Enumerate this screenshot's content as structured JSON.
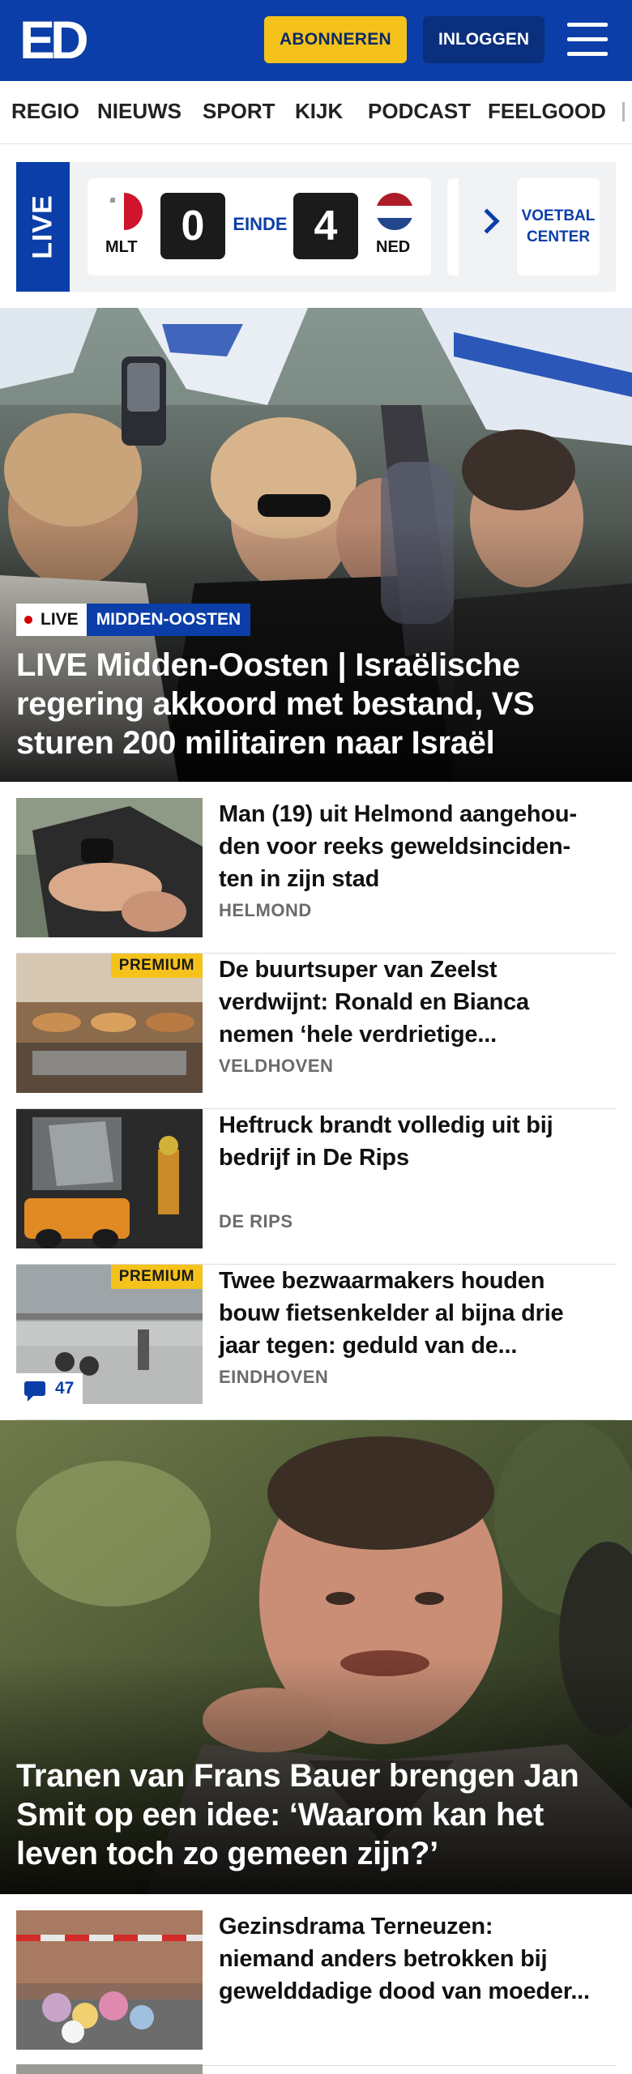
{
  "header": {
    "logo": "ED",
    "subscribe_label": "ABONNEREN",
    "login_label": "INLOGGEN",
    "menu_icon": "hamburger-icon",
    "color": "#0b3ea8"
  },
  "nav": {
    "items": [
      "REGIO",
      "NIEUWS",
      "SPORT",
      "KIJK",
      "PODCAST",
      "FEELGOOD"
    ]
  },
  "live_scores": {
    "tab_label": "LIVE",
    "match": {
      "home_code": "MLT",
      "home_score": "0",
      "status": "EINDE",
      "away_score": "4",
      "away_code": "NED"
    },
    "voetbal_center_label": "VOETBAL CENTER"
  },
  "hero_1": {
    "tag_live": "LIVE",
    "tag_category": "MIDDEN-OOSTEN",
    "title_lines": [
      "LIVE Midden-Oosten | Israëlische",
      "regering akkoord met bestand, VS",
      "sturen 200 militairen naar Israël"
    ]
  },
  "articles_1": [
    {
      "title_lines": [
        "Man (19) uit Helmond aangehou-",
        "den voor reeks geweldsinciden-",
        "ten in zijn stad"
      ],
      "location": "HELMOND",
      "premium": false
    },
    {
      "title_lines": [
        "De buurtsuper van Zeelst",
        "verdwijnt: Ronald en Bianca",
        "nemen ‘hele verdrietige..."
      ],
      "location": "VELDHOVEN",
      "premium": true,
      "premium_label": "PREMIUM"
    },
    {
      "title_lines": [
        "Heftruck brandt volledig uit bij",
        "bedrijf in De Rips"
      ],
      "location": "DE RIPS",
      "premium": false
    },
    {
      "title_lines": [
        "Twee bezwaarmakers houden",
        "bouw fietsenkelder al bijna drie",
        "jaar tegen: geduld van de..."
      ],
      "location": "EINDHOVEN",
      "premium": true,
      "premium_label": "PREMIUM",
      "comments": "47"
    }
  ],
  "hero_2": {
    "title_lines": [
      "Tranen van Frans Bauer brengen Jan",
      "Smit op een idee: ‘Waarom kan het",
      "leven toch zo gemeen zijn?’"
    ]
  },
  "articles_2": [
    {
      "title_lines": [
        "Gezinsdrama Terneuzen:",
        "niemand anders betrokken bij",
        "gewelddadige dood van moeder..."
      ],
      "location": "",
      "premium": false
    }
  ]
}
